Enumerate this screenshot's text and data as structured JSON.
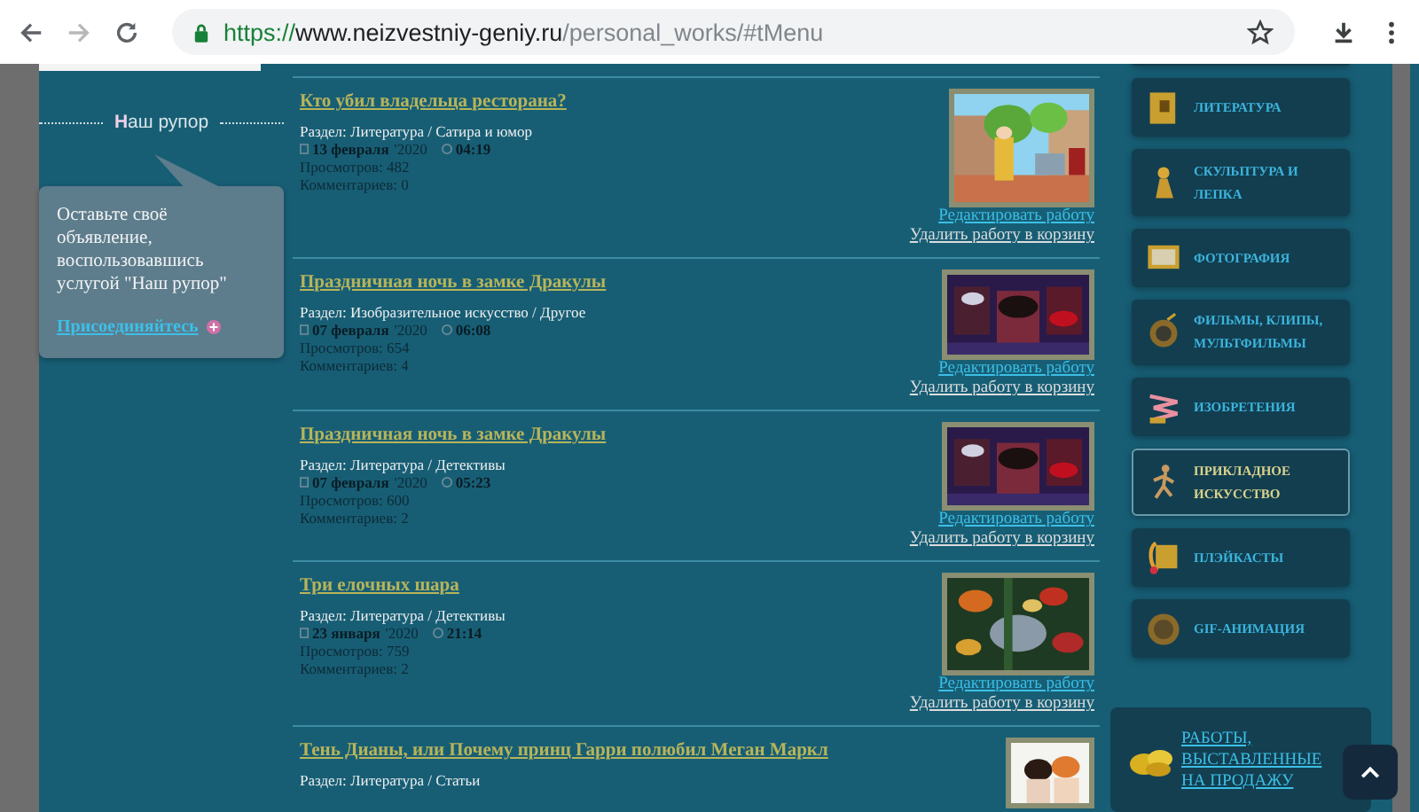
{
  "browser": {
    "url_scheme": "https://",
    "url_host": "www.neizvestniy-geniy.ru",
    "url_path": "/personal_works/#tMenu"
  },
  "promo": {
    "heading": "Наш рупор",
    "text": "Оставьте своё объявление, воспользовавшись услугой \"Наш рупор\"",
    "link": "Присоединяйтесь"
  },
  "works": [
    {
      "title": "Кто убил владельца ресторана?",
      "section": "Раздел: Литература / Сатира и юмор",
      "date": "13 февраля",
      "year": "'2020",
      "time": "04:19",
      "views": "Просмотров: 482",
      "comments": "Комментариев: 0",
      "edit": "Редактировать работу",
      "delete": "Удалить работу в корзину"
    },
    {
      "title": "Праздничная ночь в замке Дракулы",
      "section": "Раздел: Изобразительное искусство / Другое",
      "date": "07 февраля",
      "year": "'2020",
      "time": "06:08",
      "views": "Просмотров: 654",
      "comments": "Комментариев: 4",
      "edit": "Редактировать работу",
      "delete": "Удалить работу в корзину"
    },
    {
      "title": "Праздничная ночь в замке Дракулы",
      "section": "Раздел: Литература / Детективы",
      "date": "07 февраля",
      "year": "'2020",
      "time": "05:23",
      "views": "Просмотров: 600",
      "comments": "Комментариев: 2",
      "edit": "Редактировать работу",
      "delete": "Удалить работу в корзину"
    },
    {
      "title": "Три елочных шара",
      "section": "Раздел: Литература / Детективы",
      "date": "23 января",
      "year": "'2020",
      "time": "21:14",
      "views": "Просмотров: 759",
      "comments": "Комментариев: 2",
      "edit": "Редактировать работу",
      "delete": "Удалить работу в корзину"
    },
    {
      "title": "Тень Дианы, или Почему принц Гарри полюбил Меган Маркл",
      "section": "Раздел: Литература / Статьи"
    }
  ],
  "menu": [
    {
      "label": "ЛИТЕРАТУРА",
      "selected": false
    },
    {
      "label": "СКУЛЬПТУРА И ЛЕПКА",
      "selected": false
    },
    {
      "label": "ФОТОГРАФИЯ",
      "selected": false
    },
    {
      "label": "ФИЛЬМЫ, КЛИПЫ, МУЛЬТФИЛЬМЫ",
      "selected": false
    },
    {
      "label": "ИЗОБРЕТЕНИЯ",
      "selected": false
    },
    {
      "label": "ПРИКЛАДНОЕ ИСКУССТВО",
      "selected": true
    },
    {
      "label": "ПЛЭЙКАСТЫ",
      "selected": false
    },
    {
      "label": "GIF-АНИМАЦИЯ",
      "selected": false
    }
  ],
  "sale": {
    "link": "РАБОТЫ, ВЫСТАВЛЕННЫЕ НА ПРОДАЖУ"
  }
}
